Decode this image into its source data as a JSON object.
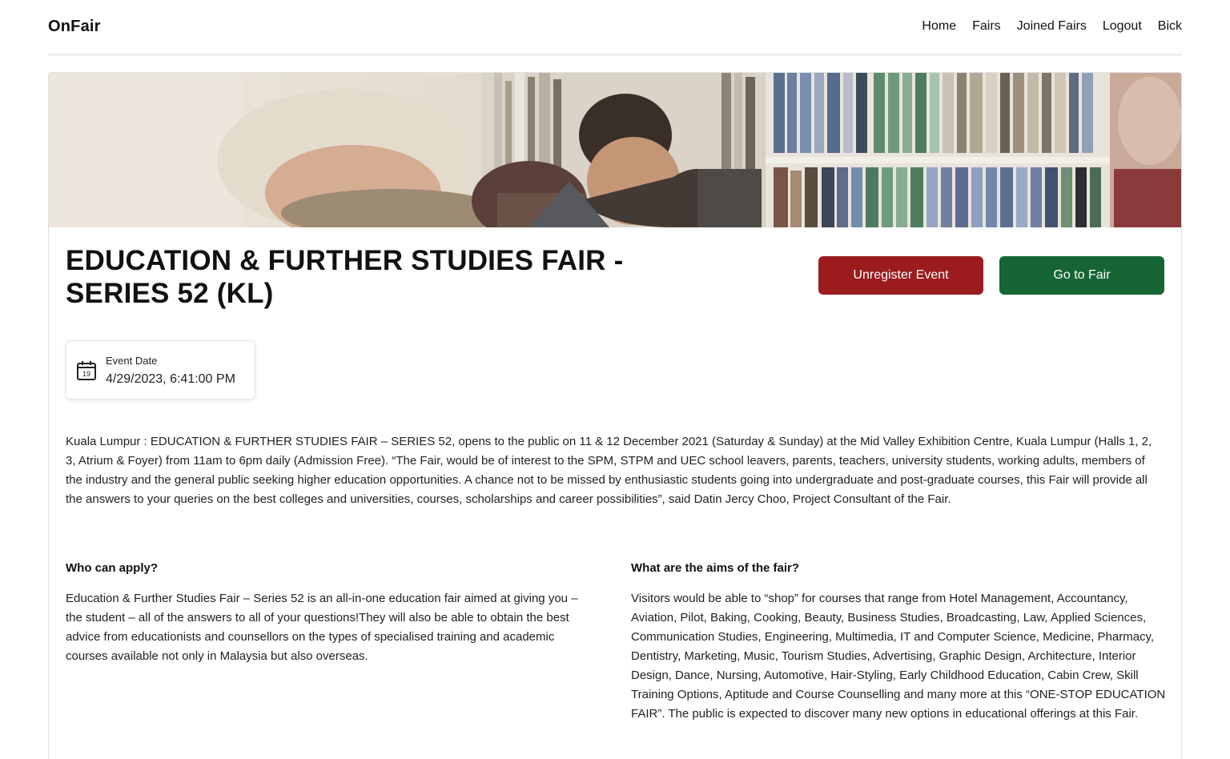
{
  "navbar": {
    "brand": "OnFair",
    "links": [
      "Home",
      "Fairs",
      "Joined Fairs",
      "Logout",
      "Bick"
    ]
  },
  "event": {
    "title": "EDUCATION & FURTHER STUDIES FAIR - SERIES 52 (KL)",
    "unregister_label": "Unregister Event",
    "go_label": "Go to Fair",
    "date_label": "Event Date",
    "date_value": "4/29/2023, 6:41:00 PM",
    "calendar_day": "19",
    "description": "Kuala Lumpur : EDUCATION & FURTHER STUDIES FAIR – SERIES 52, opens to the public on 11 & 12 December 2021 (Saturday & Sunday) at the Mid Valley Exhibition Centre, Kuala Lumpur (Halls 1, 2, 3, Atrium & Foyer) from 11am to 6pm daily (Admission Free). “The Fair, would be of interest to the SPM, STPM and UEC school leavers, parents, teachers, university students, working adults, members of the industry and the general public seeking higher education opportunities. A chance not to be missed by enthusiastic students going into undergraduate and post-graduate courses, this Fair will provide all the answers to your queries on the best colleges and universities, courses, scholarships and career possibilities”, said Datin Jercy Choo, Project Consultant of the Fair.",
    "who_heading": "Who can apply?",
    "who_text": "Education & Further Studies Fair – Series 52 is an all-in-one education fair aimed at giving you – the student – all of the answers to all of your questions!They will also be able to obtain the best advice from educationists and counsellors on the types of specialised training and academic courses available not only in Malaysia but also overseas.",
    "aims_heading": "What are the aims of the fair?",
    "aims_text": "Visitors would be able to “shop” for courses that range from Hotel Management, Accountancy, Aviation, Pilot, Baking, Cooking, Beauty, Business Studies, Broadcasting, Law, Applied Sciences, Communication Studies, Engineering, Multimedia, IT and Computer Science, Medicine, Pharmacy, Dentistry, Marketing, Music, Tourism Studies, Advertising, Graphic Design, Architecture, Interior Design, Dance, Nursing, Automotive, Hair-Styling, Early Childhood Education, Cabin Crew, Skill Training Options, Aptitude and Course Counselling and many more at this “ONE-STOP EDUCATION FAIR”. The public is expected to discover many new options in educational offerings at this Fair."
  },
  "colors": {
    "unregister": "#9b1b1e",
    "go_to_fair": "#166534"
  }
}
